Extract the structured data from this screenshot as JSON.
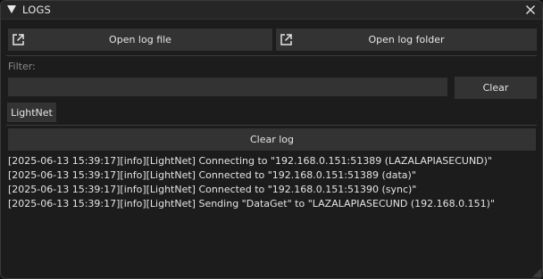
{
  "window": {
    "title": "LOGS"
  },
  "toolbar": {
    "open_log_file_label": "Open log file",
    "open_log_folder_label": "Open log folder",
    "open_icon": "external-link-icon"
  },
  "filter": {
    "label": "Filter:",
    "value": "",
    "clear_label": "Clear",
    "tags": [
      "LightNet"
    ]
  },
  "log": {
    "clear_label": "Clear log",
    "lines": [
      "[2025-06-13 15:39:17][info][LightNet] Connecting to \"192.168.0.151:51389 (LAZALAPIASECUND)\"",
      "[2025-06-13 15:39:17][info][LightNet] Connected to \"192.168.0.151:51389 (data)\"",
      "[2025-06-13 15:39:17][info][LightNet] Connected to \"192.168.0.151:51390 (sync)\"",
      "[2025-06-13 15:39:17][info][LightNet] Sending \"DataGet\" to \"LAZALAPIASECUND (192.168.0.151)\""
    ]
  },
  "colors": {
    "background": "#1c1c1c",
    "button": "#333333",
    "text": "#e4e4e4",
    "muted_text": "#8c8c8c"
  }
}
